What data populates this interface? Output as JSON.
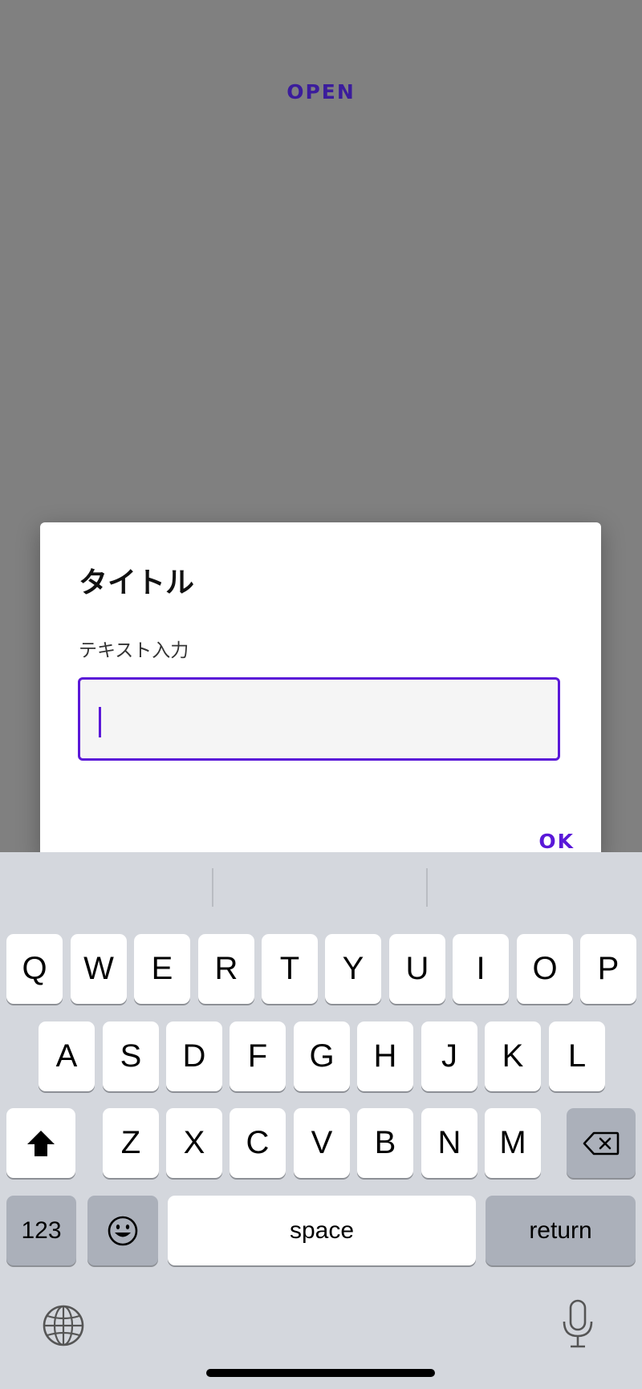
{
  "background": {
    "open_label": "OPEN"
  },
  "dialog": {
    "title": "タイトル",
    "field_label": "テキスト入力",
    "field_value": "",
    "ok_label": "OK"
  },
  "keyboard": {
    "row1": [
      "Q",
      "W",
      "E",
      "R",
      "T",
      "Y",
      "U",
      "I",
      "O",
      "P"
    ],
    "row2": [
      "A",
      "S",
      "D",
      "F",
      "G",
      "H",
      "J",
      "K",
      "L"
    ],
    "row3": [
      "Z",
      "X",
      "C",
      "V",
      "B",
      "N",
      "M"
    ],
    "numbers_label": "123",
    "space_label": "space",
    "return_label": "return",
    "icons": [
      "shift-icon",
      "delete-icon",
      "emoji-icon",
      "globe-icon",
      "microphone-icon"
    ]
  },
  "colors": {
    "accent": "#5a18d8",
    "open_text": "#3b1c9c",
    "scrim": "#808080",
    "keyboard_bg": "#d4d7dd"
  }
}
